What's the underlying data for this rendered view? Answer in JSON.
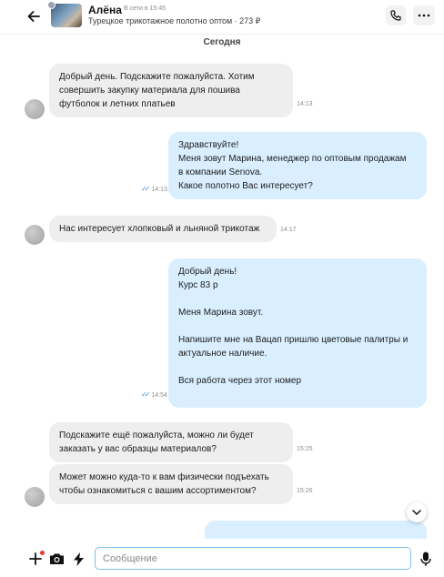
{
  "header": {
    "contact_name": "Алёна",
    "contact_status": "В сети в 15:45",
    "listing_title": "Турецкое трикотажное полотно оптом · 273 ₽"
  },
  "date_separator": "Сегодня",
  "messages": [
    {
      "direction": "incoming",
      "lines": [
        "Добрый день. Подскажите пожалуйста. Хотим",
        "совершить закупку материала для пошива",
        "футболок и летних платьев"
      ],
      "time": "14:13"
    },
    {
      "direction": "outgoing",
      "lines": [
        "Здравствуйте!",
        "Меня зовут Марина, менеджер по оптовым продажам",
        "в компании Senova.",
        "Какое полотно Вас интересует?"
      ],
      "time": "14:13",
      "read": true
    },
    {
      "direction": "incoming",
      "lines": [
        "Нас интересует хлопковый и льняной трикотаж"
      ],
      "time": "14:17"
    },
    {
      "direction": "outgoing",
      "lines": [
        "Добрый день!",
        "Курс 83 р",
        "",
        "Меня Марина зовут.",
        "",
        "Напишите мне на Вацап пришлю цветовые палитры и",
        "актуальное наличие.",
        "",
        "Вся работа через этот номер",
        ""
      ],
      "time": "14:54",
      "read": true
    },
    {
      "direction": "incoming",
      "lines": [
        "Подскажите ещё пожалуйста, можно ли будет",
        "заказать у вас образцы материалов?"
      ],
      "time": "15:25"
    },
    {
      "direction": "incoming",
      "lines": [
        "Может можно куда-то к вам физически подъехать",
        "чтобы ознакомиться с вашим ассортиментом?"
      ],
      "time": "15:26"
    },
    {
      "direction": "outgoing",
      "lines": [
        ""
      ],
      "time": ""
    }
  ],
  "composer": {
    "placeholder": "Сообщение"
  },
  "icons": {
    "back": "arrow-left-icon",
    "call": "phone-icon",
    "more": "more-horizontal-icon",
    "scroll": "chevron-down-icon",
    "plus": "plus-icon",
    "camera": "camera-icon",
    "quick": "lightning-icon",
    "mic": "microphone-icon"
  },
  "colors": {
    "outgoing_bubble": "#d9efff",
    "incoming_bubble": "#eeeeee",
    "read_checks": "#3d8bd9",
    "input_border": "#7cc0ef",
    "notification_dot": "#e53935"
  }
}
